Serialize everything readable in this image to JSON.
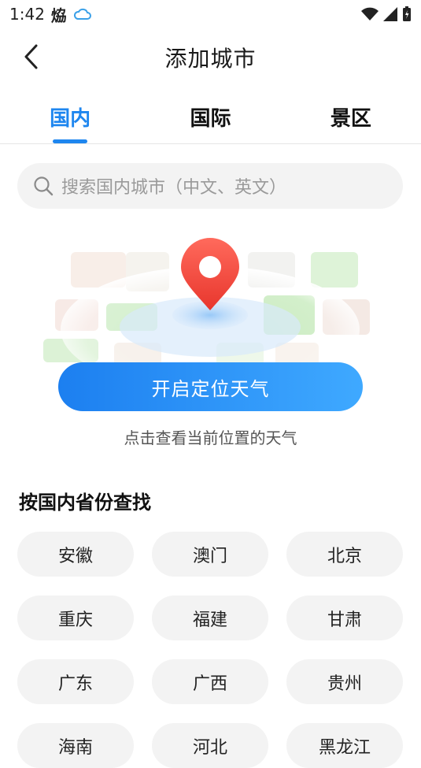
{
  "status": {
    "time": "1:42",
    "weather_glyph": "㶸",
    "icons": [
      "cloud-icon",
      "wifi-icon",
      "signal-icon",
      "battery-icon"
    ]
  },
  "header": {
    "title": "添加城市",
    "back_icon": "chevron-left-icon"
  },
  "tabs": [
    {
      "label": "国内",
      "active": true
    },
    {
      "label": "国际",
      "active": false
    },
    {
      "label": "景区",
      "active": false
    }
  ],
  "search": {
    "placeholder": "搜索国内城市（中文、英文）",
    "icon": "search-icon"
  },
  "locate": {
    "button_label": "开启定位天气",
    "hint": "点击查看当前位置的天气"
  },
  "provinces": {
    "title": "按国内省份查找",
    "items": [
      "安徽",
      "澳门",
      "北京",
      "重庆",
      "福建",
      "甘肃",
      "广东",
      "广西",
      "贵州",
      "海南",
      "河北",
      "黑龙江"
    ]
  },
  "colors": {
    "accent": "#1e86ef",
    "pin": "#f4473c",
    "chip_bg": "#f3f3f3"
  }
}
